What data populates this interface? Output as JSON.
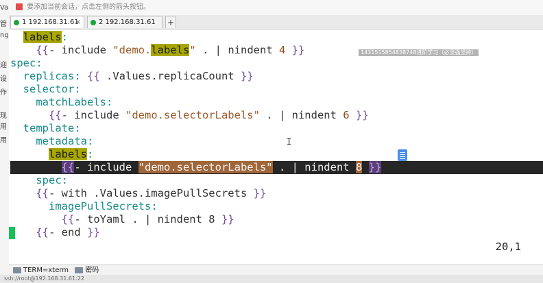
{
  "hint": {
    "text": "要添加当前会话，点击左侧的箭头按钮。"
  },
  "left_sidebar": {
    "fragments": [
      "Va",
      "管",
      "ng",
      "迎",
      "设",
      "作",
      "现",
      "用",
      "用"
    ]
  },
  "tabs": [
    {
      "label": "1 192.168.31.61",
      "active": true
    },
    {
      "label": "2 192.168.31.61",
      "active": false
    }
  ],
  "tab_add": "+",
  "editor": {
    "lines": [
      {
        "indent": "  ",
        "parts": [
          [
            "hl",
            "labels"
          ],
          [
            "k",
            ":"
          ]
        ]
      },
      {
        "indent": "    ",
        "parts": [
          [
            "b",
            "{{"
          ],
          [
            "",
            "- include "
          ],
          [
            "s",
            "\"demo."
          ],
          [
            "hl",
            "labels"
          ],
          [
            "s",
            "\""
          ],
          [
            "",
            " . | nindent "
          ],
          [
            "n",
            "4"
          ],
          [
            "",
            " "
          ],
          [
            "b",
            "}}"
          ]
        ]
      },
      {
        "indent": "",
        "parts": [
          [
            "k",
            "spec"
          ],
          [
            "k",
            ":"
          ]
        ]
      },
      {
        "indent": "  ",
        "parts": [
          [
            "k",
            "replicas"
          ],
          [
            "k",
            ":"
          ],
          [
            "",
            " "
          ],
          [
            "b",
            "{{"
          ],
          [
            "",
            " .Values.replicaCount "
          ],
          [
            "b",
            "}}"
          ]
        ]
      },
      {
        "indent": "  ",
        "parts": [
          [
            "k",
            "selector"
          ],
          [
            "k",
            ":"
          ]
        ]
      },
      {
        "indent": "    ",
        "parts": [
          [
            "k",
            "matchLabels"
          ],
          [
            "k",
            ":"
          ]
        ]
      },
      {
        "indent": "      ",
        "parts": [
          [
            "b",
            "{{"
          ],
          [
            "",
            "- include "
          ],
          [
            "s",
            "\"demo.selectorLabels\""
          ],
          [
            "",
            " . | nindent "
          ],
          [
            "n",
            "6"
          ],
          [
            "",
            " "
          ],
          [
            "b",
            "}}"
          ]
        ]
      },
      {
        "indent": "  ",
        "parts": [
          [
            "k",
            "template"
          ],
          [
            "k",
            ":"
          ]
        ]
      },
      {
        "indent": "    ",
        "parts": [
          [
            "k",
            "metadata"
          ],
          [
            "k",
            ":"
          ]
        ]
      },
      {
        "indent": "      ",
        "parts": [
          [
            "hl",
            "labels"
          ],
          [
            "k",
            ":"
          ]
        ]
      },
      {
        "indent": "        ",
        "cursor": true,
        "parts": [
          [
            "b",
            "{{"
          ],
          [
            "",
            "- include "
          ],
          [
            "hs",
            "\"demo.selectorLabels\""
          ],
          [
            "",
            " . | nindent "
          ],
          [
            "hn",
            "8"
          ],
          [
            "",
            " "
          ],
          [
            "b",
            "}}"
          ]
        ]
      },
      {
        "indent": "    ",
        "parts": [
          [
            "k",
            "spec"
          ],
          [
            "k",
            ":"
          ]
        ]
      },
      {
        "indent": "    ",
        "parts": [
          [
            "b",
            "{{"
          ],
          [
            "",
            "- with .Values.imagePullSecrets "
          ],
          [
            "b",
            "}}"
          ]
        ]
      },
      {
        "indent": "      ",
        "parts": [
          [
            "k",
            "imagePullSecrets"
          ],
          [
            "k",
            ":"
          ]
        ]
      },
      {
        "indent": "        ",
        "parts": [
          [
            "b",
            "{{"
          ],
          [
            "",
            "- toYaml . | nindent 8 "
          ],
          [
            "b",
            "}}"
          ]
        ]
      },
      {
        "indent": "    ",
        "parts": [
          [
            "b",
            "{{"
          ],
          [
            "",
            "- end "
          ],
          [
            "b",
            "}}"
          ]
        ]
      }
    ],
    "cursor_position": "20,1",
    "overlay_text": "1431515854838748进阶学习（必坚强坚持）"
  },
  "status": {
    "term_label": "TERM=xterm",
    "encoding_label": "密码"
  },
  "bottom_text": "ssh://root@192.168.31.61:22"
}
